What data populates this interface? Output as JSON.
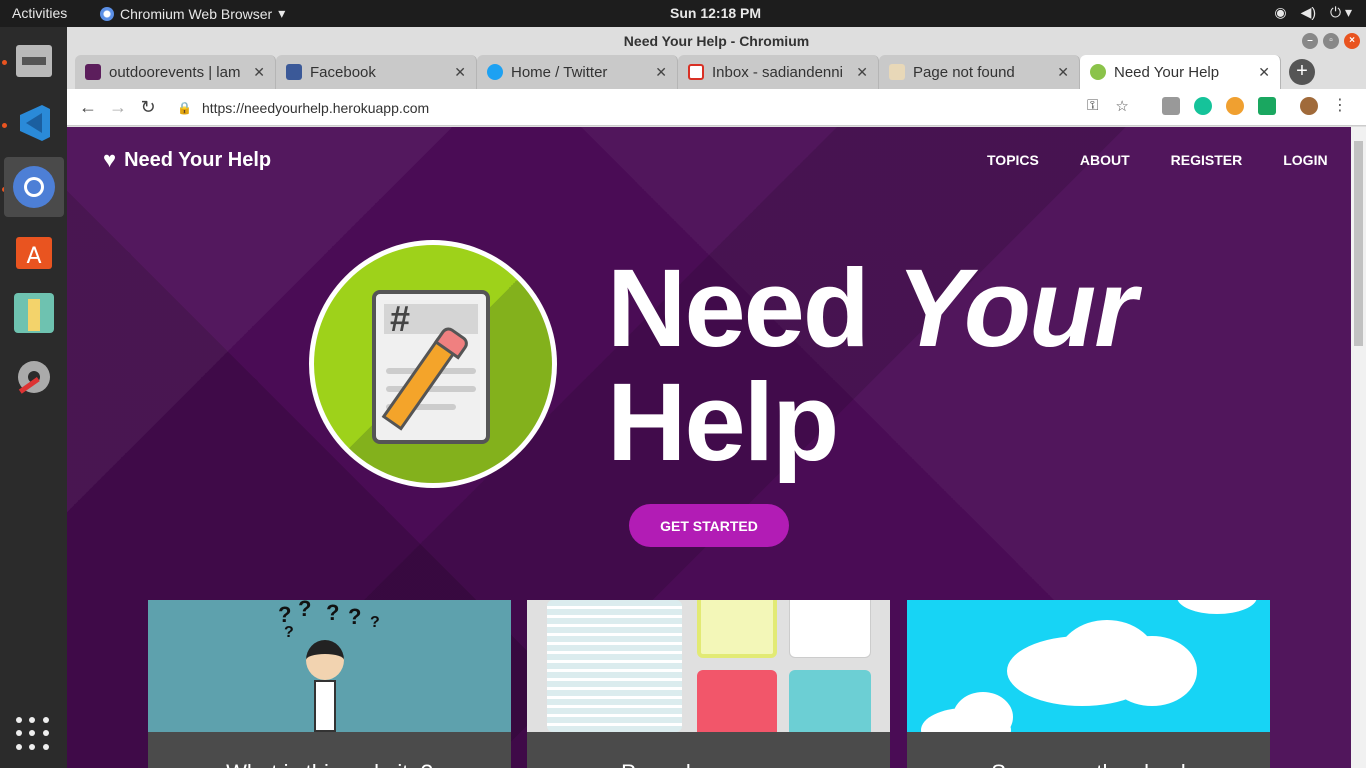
{
  "system": {
    "activities": "Activities",
    "app_name": "Chromium Web Browser",
    "clock": "Sun 12:18 PM"
  },
  "window": {
    "title": "Need Your Help - Chromium"
  },
  "tabs": [
    {
      "label": "outdoorevents | lam",
      "color": "#5c1e5c"
    },
    {
      "label": "Facebook",
      "color": "#3b5998"
    },
    {
      "label": "Home / Twitter",
      "color": "#1da1f2"
    },
    {
      "label": "Inbox - sadiandenni",
      "color": "#d93025"
    },
    {
      "label": "Page not found",
      "color": "#e8d8b8"
    },
    {
      "label": "Need Your Help",
      "color": "#8bc34a"
    }
  ],
  "address_bar": {
    "url": "https://needyourhelp.herokuapp.com"
  },
  "site": {
    "brand": "Need Your Help",
    "nav": [
      "TOPICS",
      "ABOUT",
      "REGISTER",
      "LOGIN"
    ],
    "hero_line1": "Need",
    "hero_line1_em": "Your",
    "hero_line2": "Help",
    "cta": "GET STARTED",
    "cards": [
      "What is this website?",
      "Paper less survey",
      "Survey on the cloud"
    ]
  },
  "colors": {
    "hero_bg": "#4a0c55",
    "cta": "#b21cb5",
    "dock_indicator": "#e95420"
  }
}
